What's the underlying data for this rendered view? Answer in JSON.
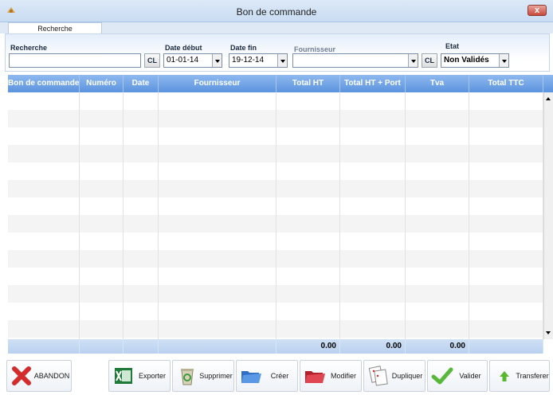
{
  "window": {
    "title": "Bon de commande",
    "close": "x"
  },
  "tabs": [
    {
      "label": "Recherche"
    }
  ],
  "filter": {
    "recherche_label": "Recherche",
    "recherche_value": "",
    "cl1": "CL",
    "date_debut_label": "Date début",
    "date_debut_value": "01-01-14",
    "date_fin_label": "Date fin",
    "date_fin_value": "19-12-14",
    "fournisseur_label": "Fournisseur",
    "fournisseur_value": "",
    "cl2": "CL",
    "etat_label": "Etat",
    "etat_value": "Non Validés"
  },
  "grid": {
    "columns": [
      "Bon de commande",
      "Numéro",
      "Date",
      "Fournisseur",
      "Total HT",
      "Total HT + Port",
      "Tva",
      "Total TTC"
    ],
    "totals": [
      "",
      "",
      "",
      "",
      "0.00",
      "0.00",
      "0.00",
      ""
    ]
  },
  "toolbar": {
    "abandon": "ABANDON",
    "exporter": "Exporter",
    "supprimer": "Supprimer",
    "creer": "Créer",
    "modifier": "Modifier",
    "dupliquer": "Dupliquer",
    "valider": "Valider",
    "transferer": "Transferer"
  }
}
